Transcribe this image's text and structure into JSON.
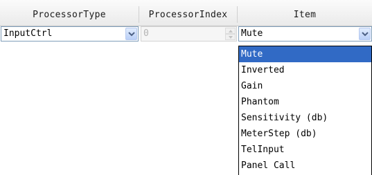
{
  "grid": {
    "headers": [
      "ProcessorType",
      "ProcessorIndex",
      "Item"
    ],
    "processor_type": {
      "value": "InputCtrl"
    },
    "processor_index": {
      "value": "0"
    },
    "item": {
      "value": "Mute",
      "options": [
        "Mute",
        "Inverted",
        "Gain",
        "Phantom",
        "Sensitivity (db)",
        "MeterStep (db)",
        "TelInput",
        "Panel Call"
      ],
      "highlighted": "Mute"
    }
  },
  "colors": {
    "highlight": "#316ac5",
    "combo_border": "#7f9db9",
    "dropdown_arrow": "#4d6185"
  },
  "icons": {
    "dropdown": "chevron-down-icon",
    "spin_up": "arrow-up-icon",
    "spin_down": "arrow-down-icon"
  }
}
